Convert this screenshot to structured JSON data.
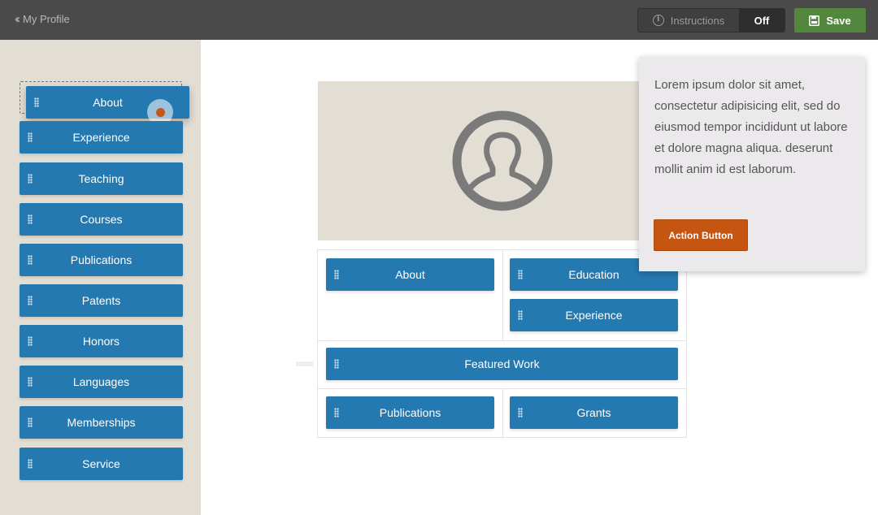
{
  "header": {
    "back_label": "My Profile",
    "instructions_label": "Instructions",
    "instructions_state": "Off",
    "save_label": "Save"
  },
  "sidebar": {
    "dragging_item": "About",
    "items": [
      {
        "label": "Experience"
      },
      {
        "label": "Teaching"
      },
      {
        "label": "Courses"
      },
      {
        "label": "Publications"
      },
      {
        "label": "Patents"
      },
      {
        "label": "Honors"
      },
      {
        "label": "Languages"
      },
      {
        "label": "Memberships"
      },
      {
        "label": "Service"
      }
    ]
  },
  "layout": {
    "about": "About",
    "education": "Education",
    "experience": "Experience",
    "featured_work": "Featured Work",
    "publications": "Publications",
    "grants": "Grants"
  },
  "tooltip": {
    "text": "Lorem ipsum dolor sit amet, consectetur adipisicing elit, sed do eiusmod tempor incididunt ut labore et dolore magna aliqua. deserunt mollit anim id est laborum.",
    "action_label": "Action Button"
  },
  "colors": {
    "topbar": "#4a4a4a",
    "sidebar_bg": "#e3ded3",
    "pill_blue": "#2479b1",
    "save_green": "#52873d",
    "action_orange": "#c75512"
  },
  "icons": [
    "double-chevron-left-icon",
    "info-icon",
    "save-disk-icon",
    "grip-icon",
    "avatar-icon"
  ]
}
